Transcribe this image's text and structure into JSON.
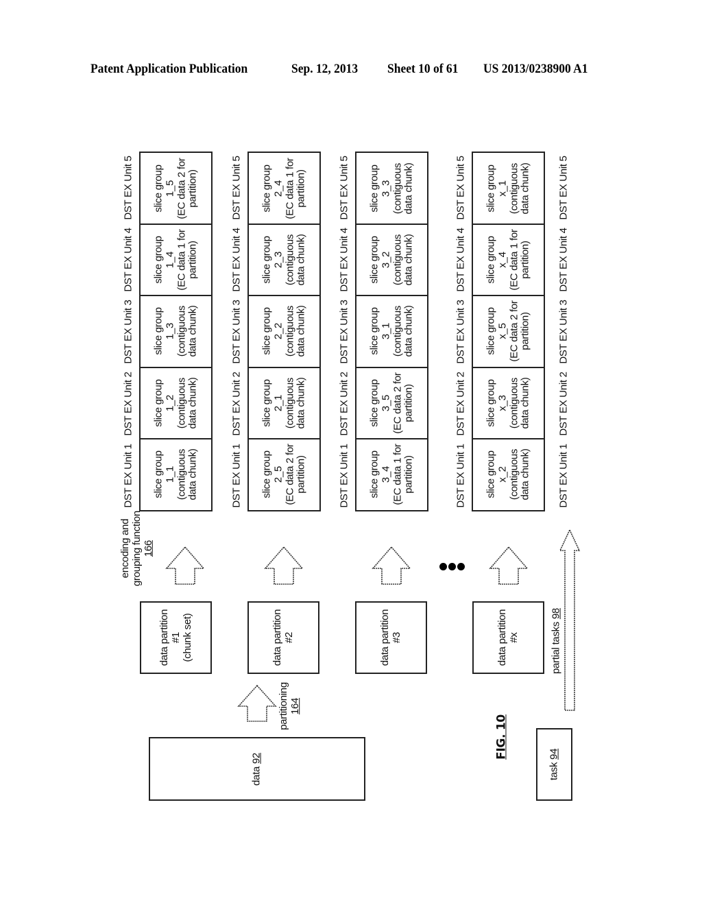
{
  "header": {
    "publication": "Patent Application Publication",
    "date": "Sep. 12, 2013",
    "sheet": "Sheet 10 of 61",
    "number": "US 2013/0238900 A1"
  },
  "figure_label": "FIG. 10",
  "unit_labels": [
    "DST EX Unit 1",
    "DST EX Unit 2",
    "DST EX Unit 3",
    "DST EX Unit 4",
    "DST EX Unit 5"
  ],
  "groups": [
    {
      "partition": {
        "line1": "data partition",
        "line2": "#1",
        "line3": "(chunk set)"
      },
      "slices": [
        {
          "name": "slice group",
          "id": "1_1",
          "desc1": "(contiguous",
          "desc2": "data chunk)"
        },
        {
          "name": "slice group",
          "id": "1_2",
          "desc1": "(contiguous",
          "desc2": "data chunk)"
        },
        {
          "name": "slice group",
          "id": "1_3",
          "desc1": "(contiguous",
          "desc2": "data chunk)"
        },
        {
          "name": "slice group",
          "id": "1_4",
          "desc1": "(EC data 1 for",
          "desc2": "partition)"
        },
        {
          "name": "slice group",
          "id": "1_5",
          "desc1": "(EC data 2 for",
          "desc2": "partition)"
        }
      ]
    },
    {
      "partition": {
        "line1": "data partition",
        "line2": "#2",
        "line3": ""
      },
      "slices": [
        {
          "name": "slice group",
          "id": "2_5",
          "desc1": "(EC data 2 for",
          "desc2": "partition)"
        },
        {
          "name": "slice group",
          "id": "2_1",
          "desc1": "(contiguous",
          "desc2": "data chunk)"
        },
        {
          "name": "slice group",
          "id": "2_2",
          "desc1": "(contiguous",
          "desc2": "data chunk)"
        },
        {
          "name": "slice group",
          "id": "2_3",
          "desc1": "(contiguous",
          "desc2": "data chunk)"
        },
        {
          "name": "slice group",
          "id": "2_4",
          "desc1": "(EC data 1 for",
          "desc2": "partition)"
        }
      ]
    },
    {
      "partition": {
        "line1": "data partition",
        "line2": "#3",
        "line3": ""
      },
      "slices": [
        {
          "name": "slice group",
          "id": "3_4",
          "desc1": "(EC data 1 for",
          "desc2": "partition)"
        },
        {
          "name": "slice group",
          "id": "3_5",
          "desc1": "(EC data 2 for",
          "desc2": "partition)"
        },
        {
          "name": "slice group",
          "id": "3_1",
          "desc1": "(contiguous",
          "desc2": "data chunk)"
        },
        {
          "name": "slice group",
          "id": "3_2",
          "desc1": "(contiguous",
          "desc2": "data chunk)"
        },
        {
          "name": "slice group",
          "id": "3_3",
          "desc1": "(contiguous",
          "desc2": "data chunk)"
        }
      ]
    },
    {
      "partition": {
        "line1": "data partition",
        "line2": "#x",
        "line3": ""
      },
      "slices": [
        {
          "name": "slice group",
          "id": "x_2",
          "desc1": "(contiguous",
          "desc2": "data chunk)"
        },
        {
          "name": "slice group",
          "id": "x_3",
          "desc1": "(contiguous",
          "desc2": "data chunk)"
        },
        {
          "name": "slice group",
          "id": "x_5",
          "desc1": "(EC data 2 for",
          "desc2": "partition)"
        },
        {
          "name": "slice group",
          "id": "x_4",
          "desc1": "(EC data 1 for",
          "desc2": "partition)"
        },
        {
          "name": "slice group",
          "id": "x_1",
          "desc1": "(contiguous",
          "desc2": "data chunk)"
        }
      ]
    }
  ],
  "labels": {
    "encoding_line1": "encoding and",
    "encoding_line2": "grouping function",
    "encoding_ref": "166",
    "partitioning": "partitioning",
    "partitioning_ref": "164",
    "data": "data",
    "data_ref": "92",
    "task": "task",
    "task_ref": "94",
    "partial_tasks": "partial tasks",
    "partial_tasks_ref": "98"
  }
}
